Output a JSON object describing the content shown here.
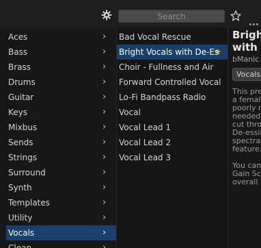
{
  "toolbar": {
    "search_placeholder": "Search"
  },
  "categories": [
    {
      "label": "Aces"
    },
    {
      "label": "Bass"
    },
    {
      "label": "Brass"
    },
    {
      "label": "Drums"
    },
    {
      "label": "Guitar"
    },
    {
      "label": "Keys"
    },
    {
      "label": "Mixbus"
    },
    {
      "label": "Sends"
    },
    {
      "label": "Strings"
    },
    {
      "label": "Surround"
    },
    {
      "label": "Synth"
    },
    {
      "label": "Templates"
    },
    {
      "label": "Utility"
    },
    {
      "label": "Vocals",
      "selected": true
    },
    {
      "label": "Clean"
    }
  ],
  "presets": [
    {
      "label": "Bad Vocal Rescue"
    },
    {
      "label": "Bright Vocals with De-Es",
      "selected": true,
      "favorite": true
    },
    {
      "label": "Choir - Fullness and Air"
    },
    {
      "label": "Forward Controlled Vocal"
    },
    {
      "label": "Lo-Fi Bandpass Radio"
    },
    {
      "label": "Vocal"
    },
    {
      "label": "Vocal Lead 1"
    },
    {
      "label": "Vocal Lead 2"
    },
    {
      "label": "Vocal Lead 3"
    }
  ],
  "detail": {
    "title_line1": "Brigh",
    "title_line2": "with I",
    "author": "bManic",
    "tag": "Vocals",
    "desc_lines": [
      "This pre",
      "a female",
      "poorly r",
      "needed",
      "cut thro",
      "De-essin",
      "spectral",
      "feature."
    ],
    "desc2_lines": [
      "You can",
      "Gain Sca",
      "overall E"
    ]
  },
  "colors": {
    "selection": "#1b3f6b",
    "favorite_star": "#e0b83a"
  }
}
